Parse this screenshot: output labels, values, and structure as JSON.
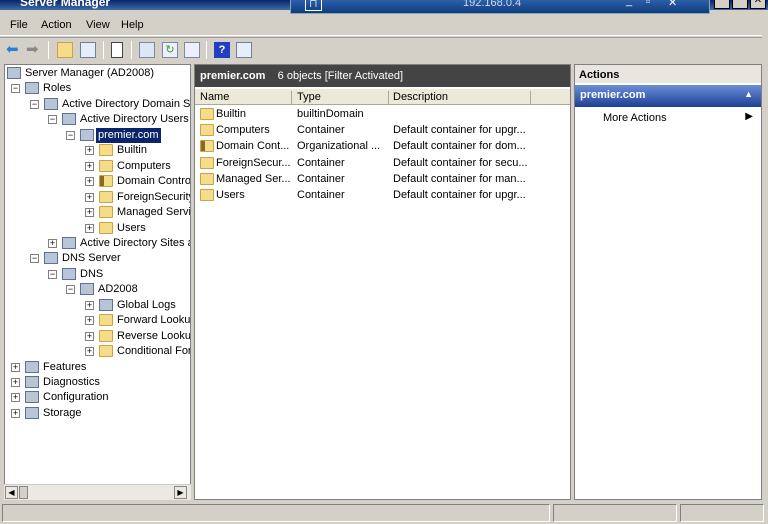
{
  "window": {
    "title": "Server Manager",
    "remote_host": "192.168.0.4"
  },
  "menu": [
    "File",
    "Action",
    "View",
    "Help"
  ],
  "toolbar": [
    "back-icon",
    "forward-icon",
    "up-folder-icon",
    "show-hide-tree-icon",
    "clipboard-icon",
    "properties-icon",
    "refresh-icon",
    "export-icon",
    "help-icon",
    "show-hide-action-pane-icon"
  ],
  "tree": [
    {
      "label": "Server Manager (AD2008)",
      "level": 0,
      "exp": "",
      "icon": "server-manager-icon"
    },
    {
      "label": "Roles",
      "level": 1,
      "exp": "-",
      "icon": "roles-icon"
    },
    {
      "label": "Active Directory Domain Se",
      "level": 2,
      "exp": "-",
      "icon": "ad-domain-services-icon"
    },
    {
      "label": "Active Directory Users",
      "level": 3,
      "exp": "-",
      "icon": "ad-users-computers-icon"
    },
    {
      "label": "premier.com",
      "level": 4,
      "exp": "-",
      "icon": "domain-icon",
      "selected": true
    },
    {
      "label": "Builtin",
      "level": 5,
      "exp": "+",
      "icon": "folder-icon"
    },
    {
      "label": "Computers",
      "level": 5,
      "exp": "+",
      "icon": "folder-icon"
    },
    {
      "label": "Domain Control",
      "level": 5,
      "exp": "+",
      "icon": "ou-folder-icon"
    },
    {
      "label": "ForeignSecurity",
      "level": 5,
      "exp": "+",
      "icon": "folder-icon"
    },
    {
      "label": "Managed Servic",
      "level": 5,
      "exp": "+",
      "icon": "folder-icon"
    },
    {
      "label": "Users",
      "level": 5,
      "exp": "+",
      "icon": "folder-icon"
    },
    {
      "label": "Active Directory Sites a",
      "level": 3,
      "exp": "+",
      "icon": "ad-sites-icon"
    },
    {
      "label": "DNS Server",
      "level": 2,
      "exp": "-",
      "icon": "dns-icon"
    },
    {
      "label": "DNS",
      "level": 3,
      "exp": "-",
      "icon": "dns-icon"
    },
    {
      "label": "AD2008",
      "level": 4,
      "exp": "-",
      "icon": "server-icon"
    },
    {
      "label": "Global Logs",
      "level": 5,
      "exp": "+",
      "icon": "logs-icon"
    },
    {
      "label": "Forward Lookup",
      "level": 5,
      "exp": "+",
      "icon": "folder-icon"
    },
    {
      "label": "Reverse Lookup",
      "level": 5,
      "exp": "+",
      "icon": "folder-icon"
    },
    {
      "label": "Conditional For",
      "level": 5,
      "exp": "+",
      "icon": "folder-icon"
    },
    {
      "label": "Features",
      "level": 1,
      "exp": "+",
      "icon": "features-icon"
    },
    {
      "label": "Diagnostics",
      "level": 1,
      "exp": "+",
      "icon": "diagnostics-icon"
    },
    {
      "label": "Configuration",
      "level": 1,
      "exp": "+",
      "icon": "configuration-icon"
    },
    {
      "label": "Storage",
      "level": 1,
      "exp": "+",
      "icon": "storage-icon"
    }
  ],
  "center": {
    "title": "premier.com",
    "count": "6 objects",
    "filter": "[Filter Activated]",
    "columns": [
      "Name",
      "Type",
      "Description"
    ],
    "rows": [
      {
        "name": "Builtin",
        "type": "builtinDomain",
        "desc": "",
        "icon": "folder-icon"
      },
      {
        "name": "Computers",
        "type": "Container",
        "desc": "Default container for upgr...",
        "icon": "folder-icon"
      },
      {
        "name": "Domain Cont...",
        "type": "Organizational ...",
        "desc": "Default container for dom...",
        "icon": "ou-folder-icon"
      },
      {
        "name": "ForeignSecur...",
        "type": "Container",
        "desc": "Default container for secu...",
        "icon": "folder-icon"
      },
      {
        "name": "Managed Ser...",
        "type": "Container",
        "desc": "Default container for man...",
        "icon": "folder-icon"
      },
      {
        "name": "Users",
        "type": "Container",
        "desc": "Default container for upgr...",
        "icon": "folder-icon"
      }
    ]
  },
  "actions": {
    "title": "Actions",
    "section": "premier.com",
    "items": [
      "More Actions"
    ]
  }
}
